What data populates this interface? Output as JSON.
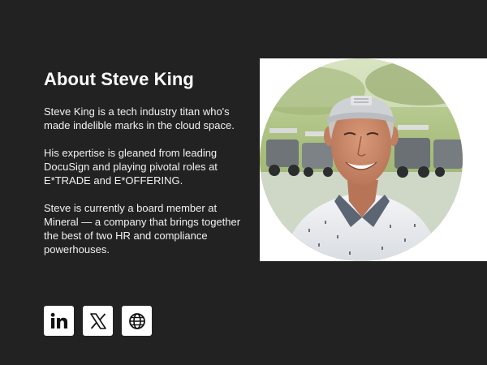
{
  "about": {
    "title": "About Steve King",
    "paragraphs": [
      "Steve King is a tech industry titan who's made indelible marks in the cloud space.",
      "His expertise is gleaned from leading DocuSign and playing pivotal roles at E*TRADE and E*OFFERING.",
      "Steve is currently a board member at Mineral — a company that brings together the best of two HR and compliance powerhouses."
    ]
  },
  "photo": {
    "subject": "portrait-photo"
  },
  "social": {
    "links": [
      {
        "icon": "linkedin-icon"
      },
      {
        "icon": "x-icon"
      },
      {
        "icon": "globe-icon"
      }
    ]
  },
  "colors": {
    "background": "#222222",
    "text": "#ffffff",
    "icon_bg": "#ffffff",
    "icon_fg": "#111111"
  }
}
